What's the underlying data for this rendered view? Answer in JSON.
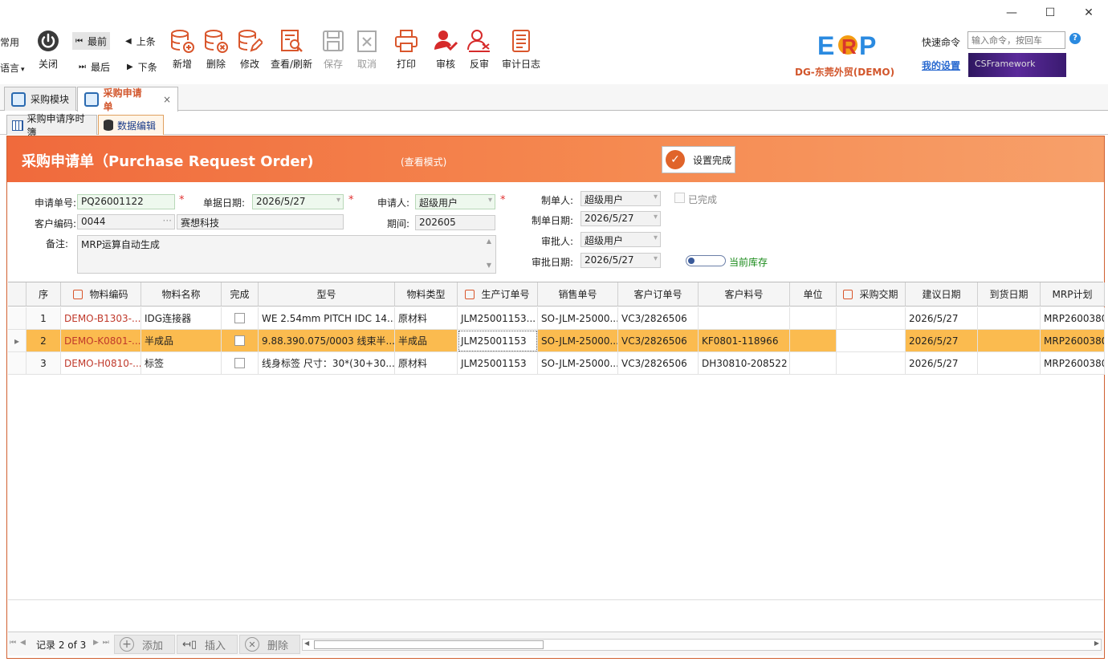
{
  "window": {
    "minimize": "—",
    "maximize": "☐",
    "close": "✕"
  },
  "toolbar": {
    "left_partial": [
      "常用",
      "语言"
    ],
    "close": "关闭",
    "nav": {
      "first": "最前",
      "prev": "上条",
      "last": "最后",
      "next": "下条"
    },
    "buttons": [
      "新增",
      "删除",
      "修改",
      "查看/刷新",
      "保存",
      "取消",
      "打印",
      "审核",
      "反审",
      "审计日志"
    ],
    "brand": "DG-东莞外贸(DEMO)",
    "quick_cmd_label": "快速命令",
    "quick_cmd_placeholder": "输入命令，按回车",
    "my_settings": "我的设置",
    "cs_banner": "CSFramework"
  },
  "tabs": {
    "module": "采购模块",
    "active": "采购申请单"
  },
  "subtabs": {
    "list": "采购申请序时簿",
    "edit": "数据编辑"
  },
  "banner": {
    "title": "采购申请单（Purchase Request Order)",
    "mode": "(查看模式)",
    "done_btn": "设置完成"
  },
  "form": {
    "req_no_label": "申请单号:",
    "req_no": "PQ26001122",
    "date_label": "单据日期:",
    "date": "2026/5/27",
    "applicant_label": "申请人:",
    "applicant": "超级用户",
    "maker_label": "制单人:",
    "maker": "超级用户",
    "completed_label": "已完成",
    "cust_label": "客户编码:",
    "cust_code": "0044",
    "cust_name": "赛想科技",
    "period_label": "期间:",
    "period": "202605",
    "make_date_label": "制单日期:",
    "make_date": "2026/5/27",
    "remark_label": "备注:",
    "remark": "MRP运算自动生成",
    "approver_label": "审批人:",
    "approver": "超级用户",
    "approve_date_label": "审批日期:",
    "approve_date": "2026/5/27",
    "stock_label": "当前库存"
  },
  "grid": {
    "headers": [
      "序",
      "物料编码",
      "物料名称",
      "完成",
      "型号",
      "物料类型",
      "生产订单号",
      "销售单号",
      "客户订单号",
      "客户料号",
      "单位",
      "采购交期",
      "建议日期",
      "到货日期",
      "MRP计划"
    ],
    "rows": [
      [
        "1",
        "DEMO-B1303-...",
        "IDG连接器",
        "",
        "WE 2.54mm PITCH IDC 14...",
        "原材料",
        "JLM25001153...",
        "SO-JLM-25000...",
        "VC3/2826506",
        "",
        "",
        "",
        "2026/5/27",
        "",
        "MRP2600380"
      ],
      [
        "2",
        "DEMO-K0801-...",
        "半成品",
        "",
        "9.88.390.075/0003 线束半...",
        "半成品",
        "JLM25001153",
        "SO-JLM-25000...",
        "VC3/2826506",
        "KF0801-118966",
        "",
        "",
        "2026/5/27",
        "",
        "MRP2600380"
      ],
      [
        "3",
        "DEMO-H0810-...",
        "标签",
        "",
        "线身标签 尺寸：30*(30+30...",
        "原材料",
        "JLM25001153",
        "SO-JLM-25000...",
        "VC3/2826506",
        "DH30810-208522",
        "",
        "",
        "2026/5/27",
        "",
        "MRP2600380"
      ]
    ]
  },
  "footer": {
    "record": "记录 2 of 3",
    "add": "添加",
    "insert": "插入",
    "delete": "删除"
  }
}
